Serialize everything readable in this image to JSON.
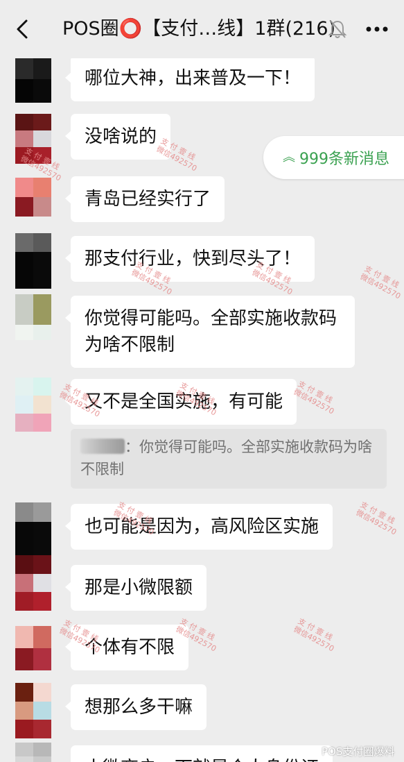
{
  "header": {
    "title": "POS圈⭕【支付…线】1群(216)",
    "back_icon": "chevron-left-icon",
    "mute_icon": "bell-off-icon",
    "more_icon": "more-dots-icon"
  },
  "new_messages": {
    "label": "999条新消息",
    "icon": "double-chevron-up-icon",
    "color": "#3aa150"
  },
  "messages": [
    {
      "text": "哪位大神，出来普及一下！"
    },
    {
      "text": "没啥说的"
    },
    {
      "text": "青岛已经实行了"
    },
    {
      "text": "那支付行业，快到尽头了！"
    },
    {
      "text": "你觉得可能吗。全部实施收款码为啥不限制"
    },
    {
      "text": "又不是全国实施，有可能"
    },
    {
      "text": "也可能是因为，高风险区实施"
    },
    {
      "text": "那是小微限额"
    },
    {
      "text": "个体有不限"
    },
    {
      "text": "想那么多干嘛"
    },
    {
      "text": "小微商户，下就是个人身份证"
    }
  ],
  "quote": {
    "text": "：你觉得可能吗。全部实施收款码为啥不限制"
  },
  "watermark": {
    "line1": "支 付 壹 线",
    "line2": "微信492570"
  },
  "footer_watermark": {
    "text": "POS支付圈爆料"
  }
}
